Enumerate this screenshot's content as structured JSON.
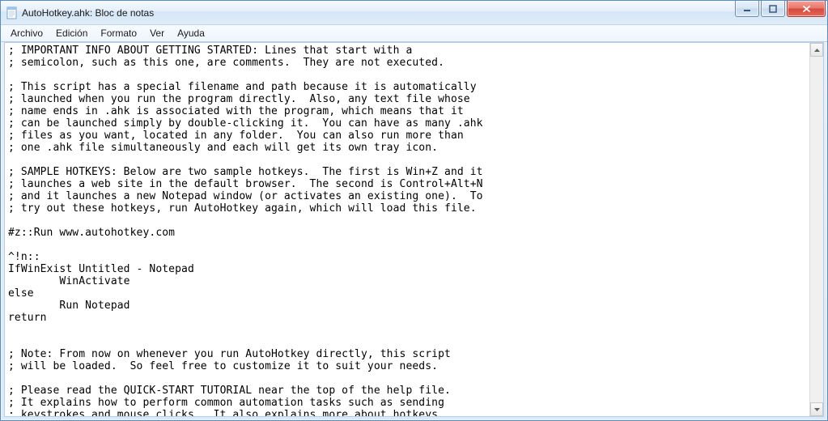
{
  "window": {
    "title": "AutoHotkey.ahk: Bloc de notas"
  },
  "menu": {
    "items": [
      "Archivo",
      "Edición",
      "Formato",
      "Ver",
      "Ayuda"
    ]
  },
  "editor": {
    "content": "; IMPORTANT INFO ABOUT GETTING STARTED: Lines that start with a\n; semicolon, such as this one, are comments.  They are not executed.\n\n; This script has a special filename and path because it is automatically\n; launched when you run the program directly.  Also, any text file whose\n; name ends in .ahk is associated with the program, which means that it\n; can be launched simply by double-clicking it.  You can have as many .ahk\n; files as you want, located in any folder.  You can also run more than\n; one .ahk file simultaneously and each will get its own tray icon.\n\n; SAMPLE HOTKEYS: Below are two sample hotkeys.  The first is Win+Z and it\n; launches a web site in the default browser.  The second is Control+Alt+N\n; and it launches a new Notepad window (or activates an existing one).  To\n; try out these hotkeys, run AutoHotkey again, which will load this file.\n\n#z::Run www.autohotkey.com\n\n^!n::\nIfWinExist Untitled - Notepad\n        WinActivate\nelse\n        Run Notepad\nreturn\n\n\n; Note: From now on whenever you run AutoHotkey directly, this script\n; will be loaded.  So feel free to customize it to suit your needs.\n\n; Please read the QUICK-START TUTORIAL near the top of the help file.\n; It explains how to perform common automation tasks such as sending\n; keystrokes and mouse clicks.  It also explains more about hotkeys."
  }
}
